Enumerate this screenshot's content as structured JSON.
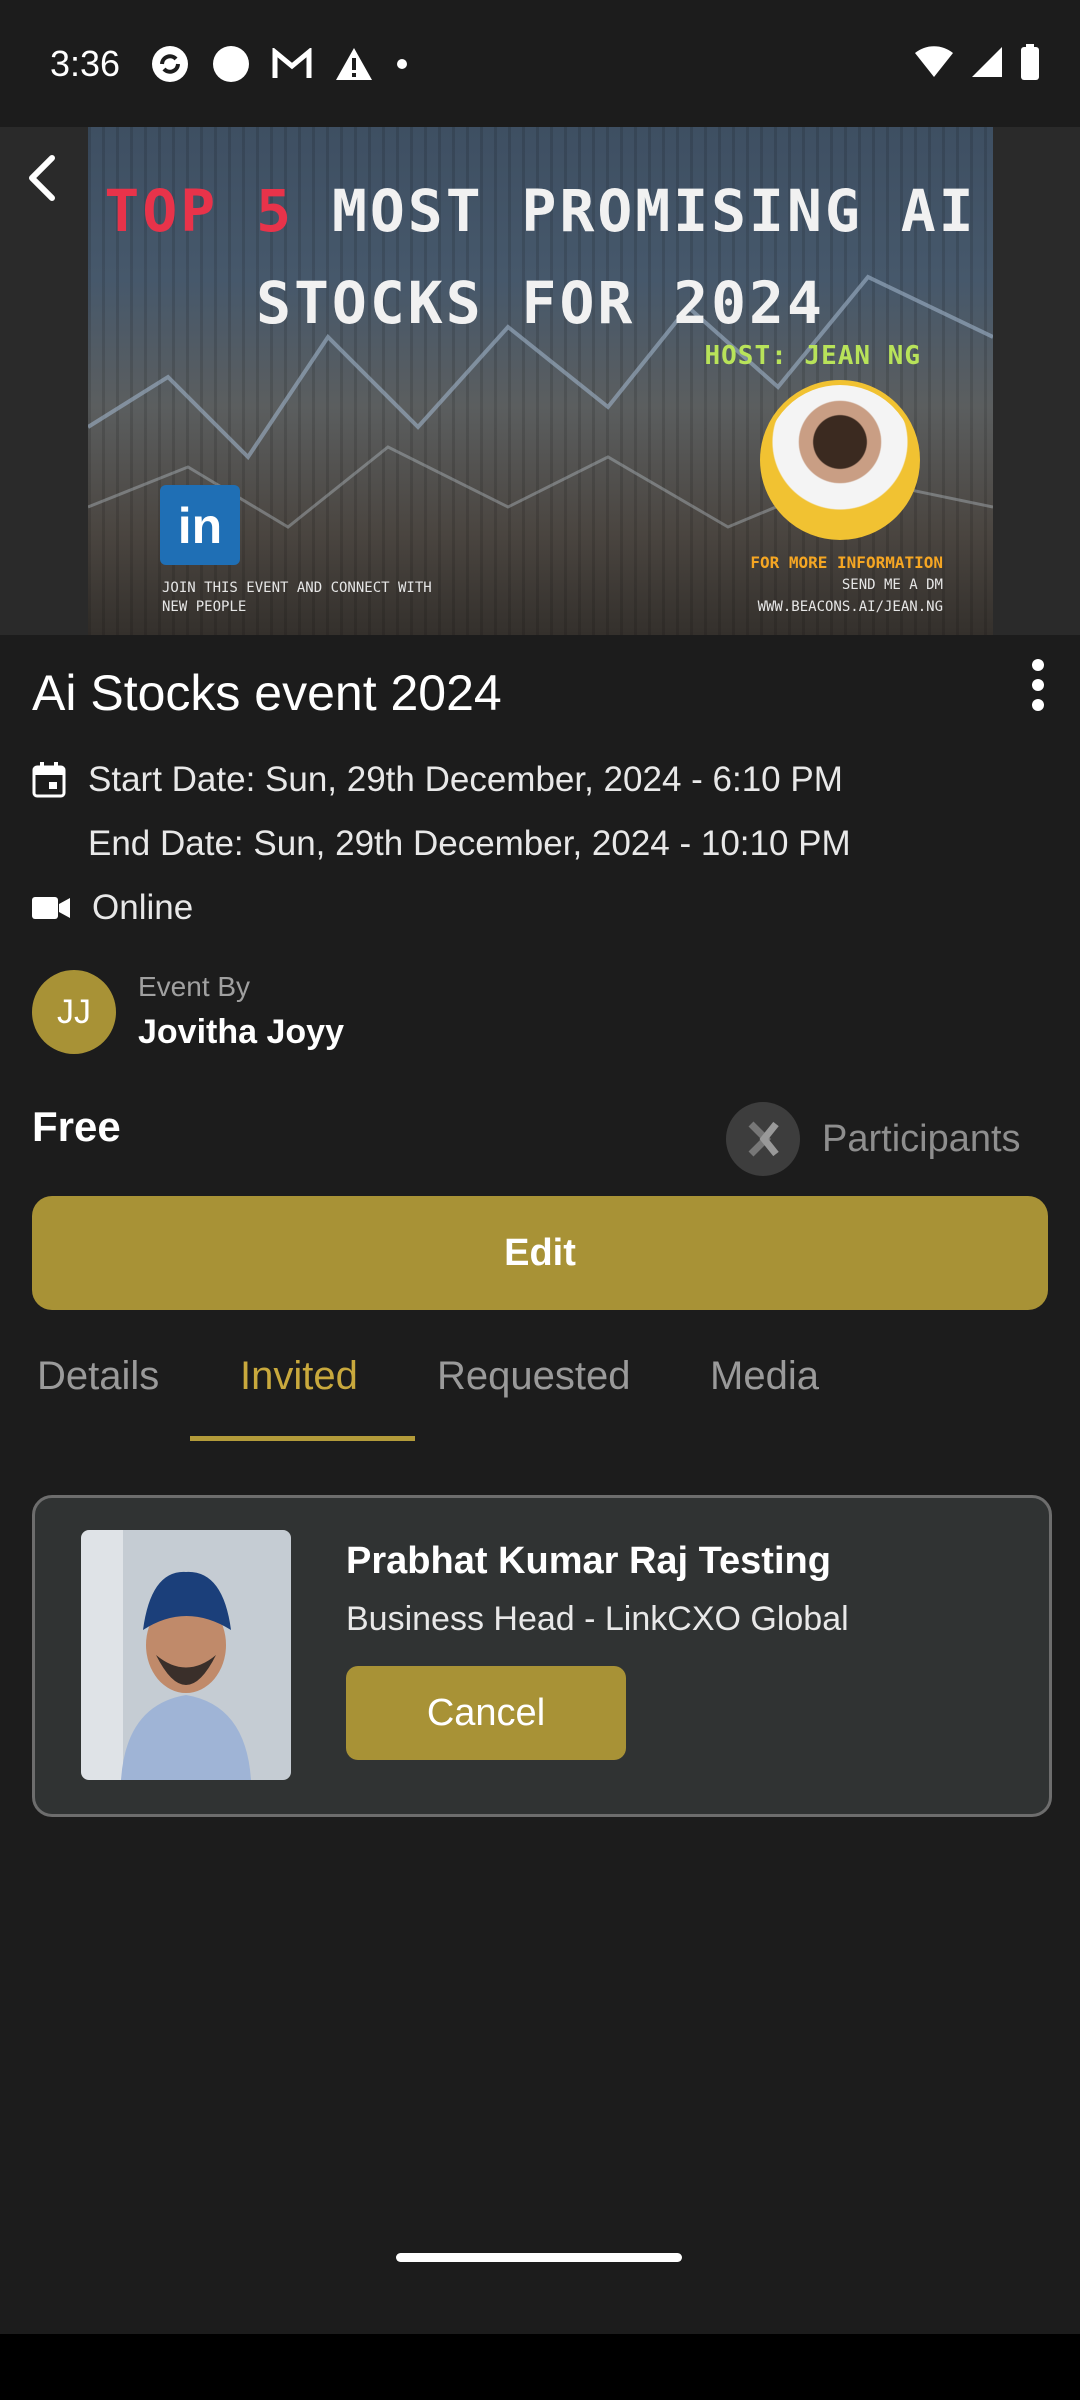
{
  "status_bar": {
    "time": "3:36"
  },
  "banner": {
    "title_highlight": "TOP 5",
    "title_rest_line1": "MOST PROMISING AI",
    "title_line2": "STOCKS FOR 2024",
    "host": "HOST: JEAN NG",
    "linkedin": "in",
    "join_line1": "JOIN THIS EVENT AND CONNECT WITH",
    "join_line2": "NEW PEOPLE",
    "more_info": "FOR MORE INFORMATION",
    "send_dm": "SEND ME A DM",
    "website": "WWW.BEACONS.AI/JEAN.NG"
  },
  "event": {
    "title": "Ai Stocks event 2024",
    "start_date": "Start Date: Sun, 29th December, 2024 - 6:10 PM",
    "end_date": "End Date: Sun, 29th December, 2024 - 10:10 PM",
    "location": "Online",
    "event_by_label": "Event By",
    "organizer_initials": "JJ",
    "organizer": "Jovitha Joyy",
    "price": "Free",
    "participants_label": "Participants",
    "edit_label": "Edit"
  },
  "tabs": [
    {
      "label": "Details"
    },
    {
      "label": "Invited"
    },
    {
      "label": "Requested"
    },
    {
      "label": "Media"
    }
  ],
  "active_tab": "Invited",
  "invited": [
    {
      "name": "Prabhat Kumar Raj Testing",
      "role": "Business Head - LinkCXO Global",
      "action": "Cancel"
    }
  ],
  "colors": {
    "accent": "#a89236",
    "background": "#1c1c1c",
    "tab_active": "#c9a93d"
  }
}
